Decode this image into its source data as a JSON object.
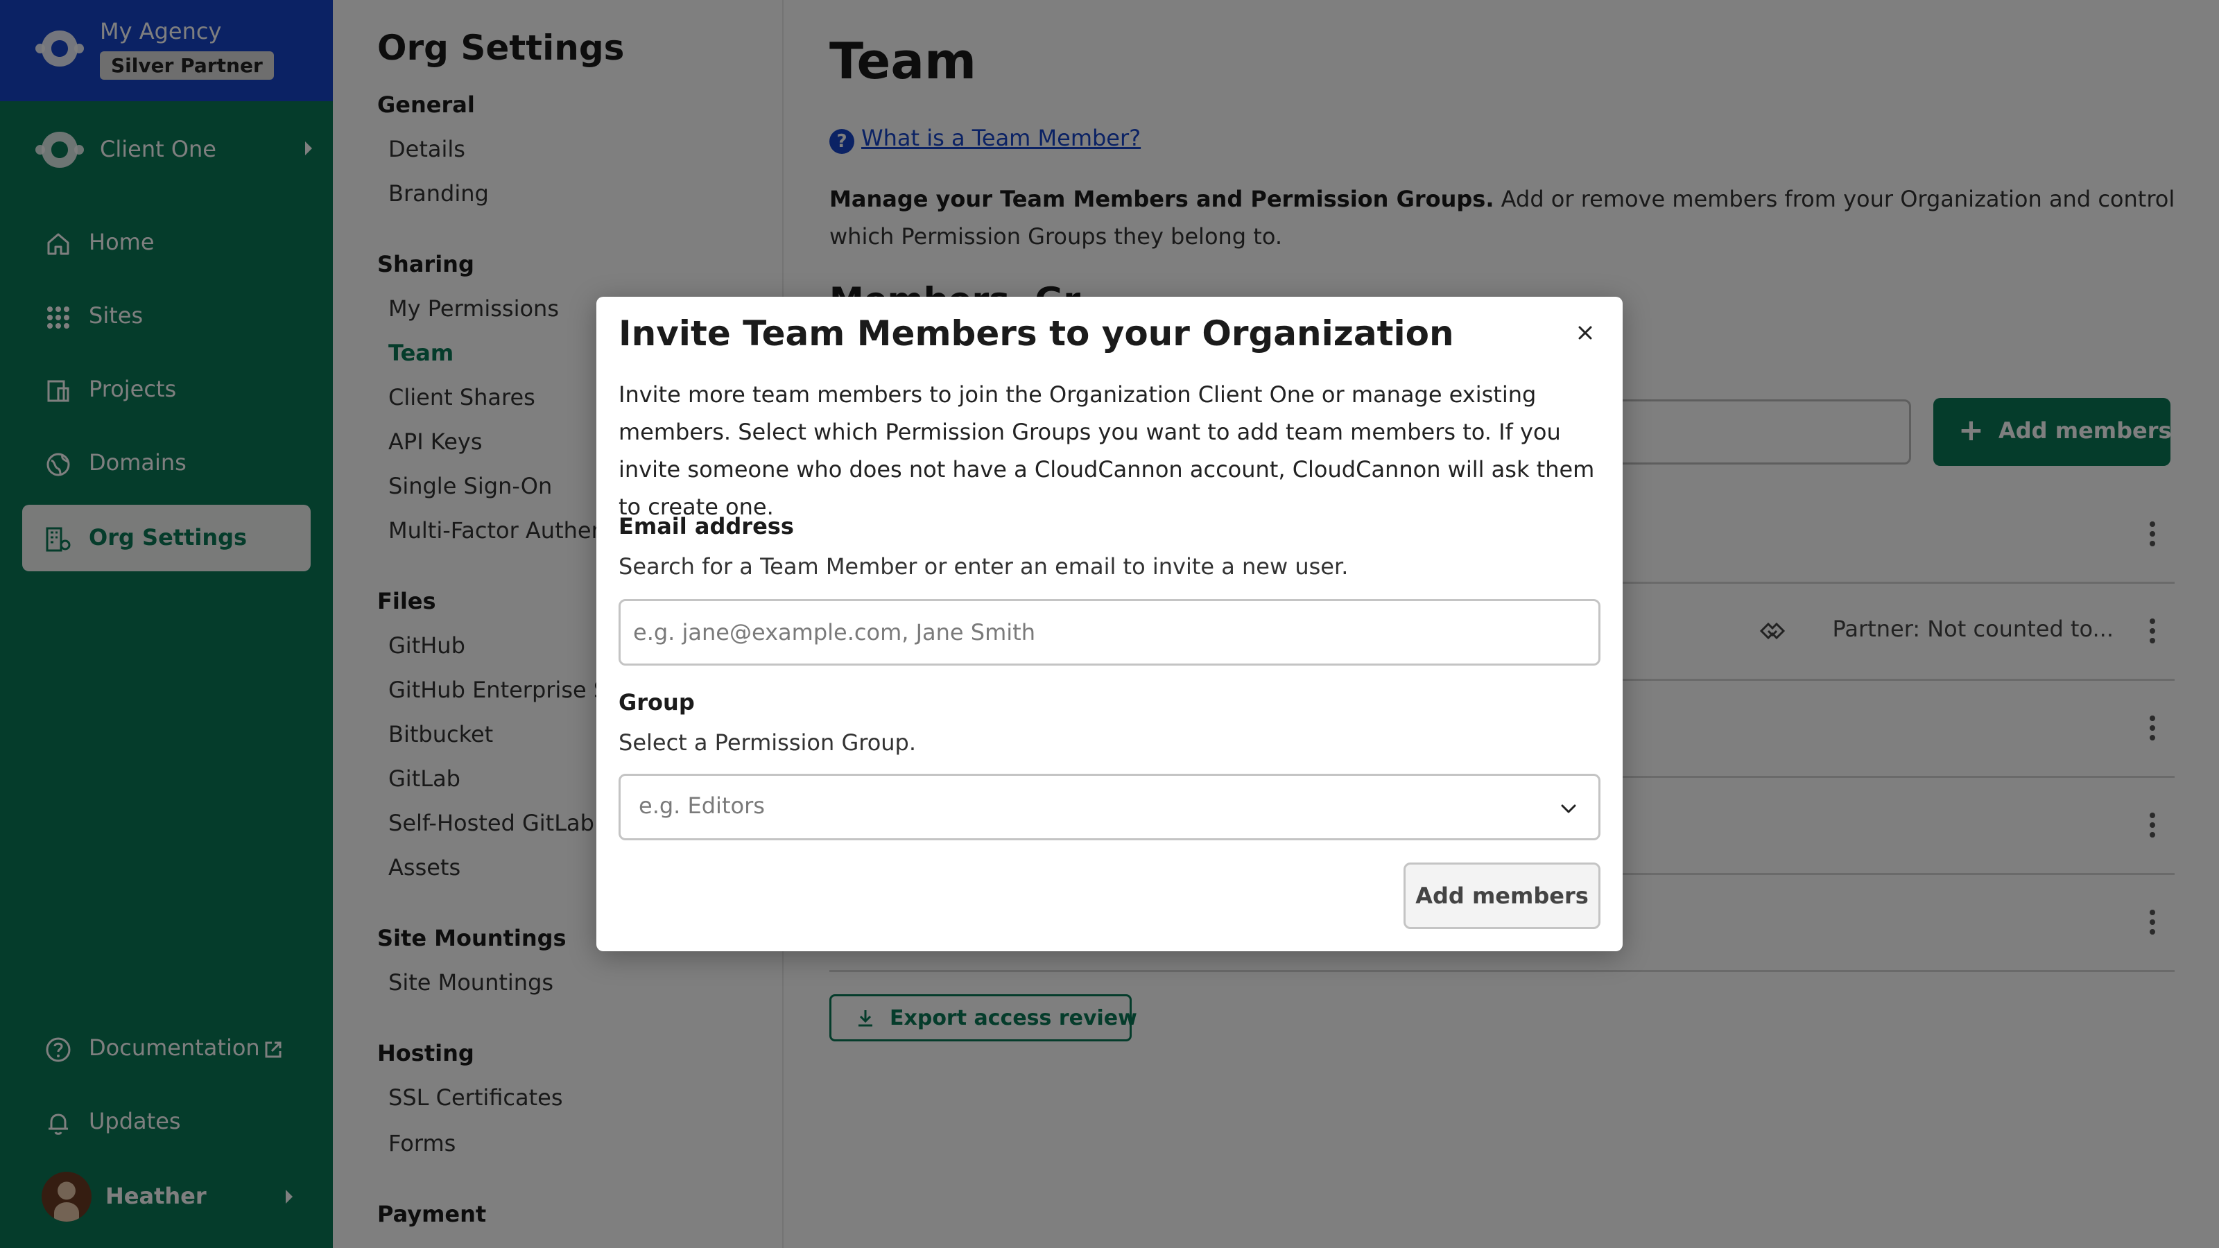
{
  "colors": {
    "brand_green": "#0b7857",
    "agency_blue": "#1744c9",
    "link_blue": "#1744c9"
  },
  "agency": {
    "name": "My Agency",
    "badge": "Silver Partner",
    "icon": "cloudcannon-logo-icon"
  },
  "client": {
    "name": "Client One",
    "icon": "cloudcannon-logo-icon"
  },
  "nav": [
    {
      "label": "Home",
      "icon": "home-icon"
    },
    {
      "label": "Sites",
      "icon": "grid-icon"
    },
    {
      "label": "Projects",
      "icon": "projects-icon"
    },
    {
      "label": "Domains",
      "icon": "globe-icon"
    },
    {
      "label": "Org Settings",
      "icon": "org-settings-icon",
      "active": true
    }
  ],
  "nav_bottom": [
    {
      "label": "Documentation",
      "icon": "help-circle-icon"
    },
    {
      "label": "Updates",
      "icon": "bell-icon"
    }
  ],
  "user": {
    "name": "Heather"
  },
  "settings": {
    "title": "Org Settings",
    "sections": [
      {
        "heading": "General",
        "items": [
          "Details",
          "Branding"
        ]
      },
      {
        "heading": "Sharing",
        "items": [
          "My Permissions",
          "Team",
          "Client Shares",
          "API Keys",
          "Single Sign-On",
          "Multi-Factor Authent"
        ]
      },
      {
        "heading": "Files",
        "items": [
          "GitHub",
          "GitHub Enterprise Se",
          "Bitbucket",
          "GitLab",
          "Self-Hosted GitLab",
          "Assets"
        ]
      },
      {
        "heading": "Site Mountings",
        "items": [
          "Site Mountings"
        ]
      },
      {
        "heading": "Hosting",
        "items": [
          "SSL Certificates",
          "Forms"
        ]
      },
      {
        "heading": "Payment",
        "items": []
      }
    ],
    "active_item": "Team"
  },
  "main": {
    "title": "Team",
    "help_link": "What is a Team Member?",
    "desc_bold": "Manage your Team Members and Permission Groups.",
    "desc_rest": " Add or remove members from your Organization and control which Permission Groups they belong to.",
    "section_title": "Members, Gr",
    "add_members_label": "Add members",
    "member_role": "Partner: Not counted to...",
    "export_label": "Export access review"
  },
  "modal": {
    "title": "Invite Team Members to your Organization",
    "description": "Invite more team members to join the Organization Client One or manage existing members. Select which Permission Groups you want to add team members to. If you invite someone who does not have a CloudCannon account, CloudCannon will ask them to create one.",
    "email_label": "Email address",
    "email_help": "Search for a Team Member or enter an email to invite a new user.",
    "email_placeholder": "e.g. jane@example.com, Jane Smith",
    "group_label": "Group",
    "group_help": "Select a Permission Group.",
    "group_placeholder": "e.g. Editors",
    "submit_label": "Add members"
  }
}
